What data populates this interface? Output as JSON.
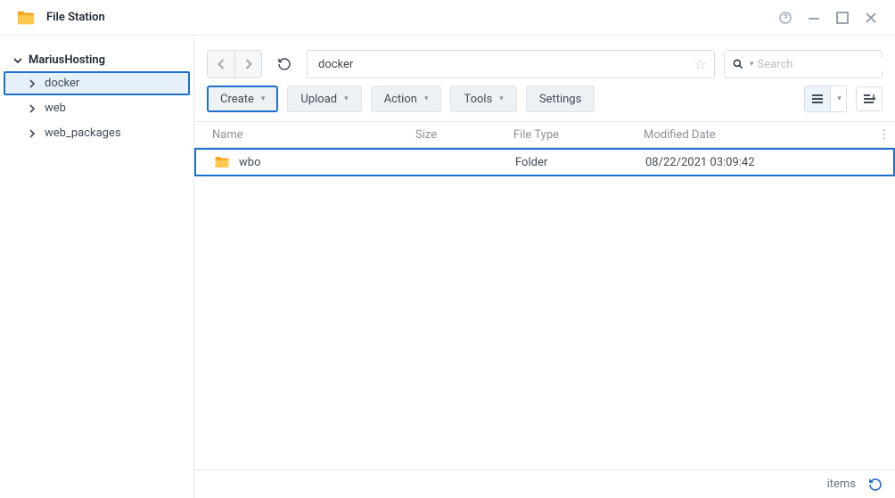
{
  "window": {
    "title": "File Station"
  },
  "sidebar": {
    "root": "MariusHosting",
    "items": [
      {
        "label": "docker",
        "selected": true
      },
      {
        "label": "web",
        "selected": false
      },
      {
        "label": "web_packages",
        "selected": false
      }
    ]
  },
  "toolbar": {
    "path": "docker",
    "search_placeholder": "Search",
    "buttons": {
      "create": "Create",
      "upload": "Upload",
      "action": "Action",
      "tools": "Tools",
      "settings": "Settings"
    }
  },
  "table": {
    "columns": {
      "name": "Name",
      "size": "Size",
      "type": "File Type",
      "date": "Modified Date"
    },
    "rows": [
      {
        "name": "wbo",
        "size": "",
        "type": "Folder",
        "date": "08/22/2021 03:09:42"
      }
    ]
  },
  "statusbar": {
    "items_label": "items"
  }
}
